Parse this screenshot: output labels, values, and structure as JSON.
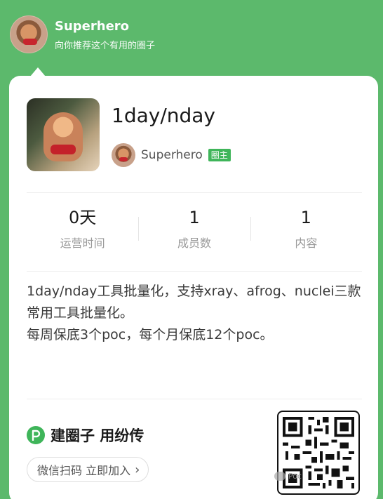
{
  "header": {
    "name": "Superhero",
    "subtitle": "向你推荐这个有用的圈子"
  },
  "circle": {
    "title": "1day/nday",
    "owner_name": "Superhero",
    "owner_badge": "圈主"
  },
  "stats": [
    {
      "value": "0天",
      "label": "运营时间"
    },
    {
      "value": "1",
      "label": "成员数"
    },
    {
      "value": "1",
      "label": "内容"
    }
  ],
  "description": {
    "line1": "1day/nday工具批量化，支持xray、afrog、nuclei三款常用工具批量化。",
    "line2": "每周保底3个poc，每个月保底12个poc。"
  },
  "footer": {
    "brand": "建圈子 用纷传",
    "scan_button": "微信扫码 立即加入",
    "scan_arrow": "›",
    "watermark": "Poc"
  },
  "colors": {
    "background": "#5cb96c",
    "accent": "#3fb55a"
  },
  "icons": {
    "brand": "p-logo-icon",
    "arrow": "chevron-right-icon",
    "watermark": "wechat-icon"
  }
}
